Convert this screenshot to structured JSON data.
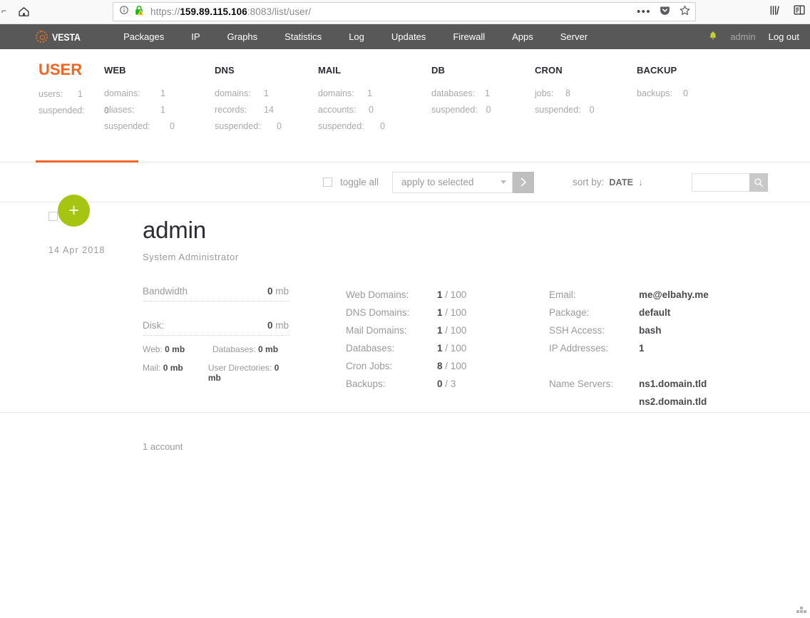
{
  "browser": {
    "home_icon": "home-icon",
    "info_icon": "info-icon",
    "lock_icon": "secure-lock-warning-icon",
    "url_scheme": "https://",
    "url_host": "159.89.115.106",
    "url_rest": ":8083/list/user/",
    "menu_icon": "ellipsis-icon",
    "pocket_icon": "pocket-icon",
    "bookmark_icon": "star-icon",
    "library_icon": "library-icon",
    "sidebar_icon": "reader-sidebar-icon"
  },
  "topnav": {
    "brand": "VESTA",
    "brand_icon": "vesta-logo-icon",
    "links": [
      {
        "label": "Packages"
      },
      {
        "label": "IP"
      },
      {
        "label": "Graphs"
      },
      {
        "label": "Statistics"
      },
      {
        "label": "Log"
      },
      {
        "label": "Updates"
      },
      {
        "label": "Firewall"
      },
      {
        "label": "Apps"
      },
      {
        "label": "Server"
      }
    ],
    "notification_icon": "bell-icon",
    "user": "admin",
    "logout": "Log out",
    "accent_color": "#f26522",
    "bar_color": "#585858"
  },
  "stats": {
    "groups": [
      {
        "title": "USER",
        "highlight": true,
        "rows": [
          {
            "key": "users:",
            "val": "1"
          },
          {
            "key": "suspended:",
            "val": "0"
          }
        ]
      },
      {
        "title": "WEB",
        "highlight": false,
        "rows": [
          {
            "key": "domains:",
            "val": "1"
          },
          {
            "key": "aliases:",
            "val": "1"
          },
          {
            "key": "suspended:",
            "val": "0"
          }
        ]
      },
      {
        "title": "DNS",
        "highlight": false,
        "rows": [
          {
            "key": "domains:",
            "val": "1"
          },
          {
            "key": "records:",
            "val": "14"
          },
          {
            "key": "suspended:",
            "val": "0"
          }
        ]
      },
      {
        "title": "MAIL",
        "highlight": false,
        "rows": [
          {
            "key": "domains:",
            "val": "1"
          },
          {
            "key": "accounts:",
            "val": "0"
          },
          {
            "key": "suspended:",
            "val": "0"
          }
        ]
      },
      {
        "title": "DB",
        "highlight": false,
        "rows": [
          {
            "key": "databases:",
            "val": "1"
          },
          {
            "key": "suspended:",
            "val": "0"
          }
        ]
      },
      {
        "title": "CRON",
        "highlight": false,
        "rows": [
          {
            "key": "jobs:",
            "val": "8"
          },
          {
            "key": "suspended:",
            "val": "0"
          }
        ]
      },
      {
        "title": "BACKUP",
        "highlight": false,
        "rows": [
          {
            "key": "backups:",
            "val": "0"
          }
        ]
      }
    ]
  },
  "toolbar": {
    "toggle_all": "toggle all",
    "apply_select_value": "apply to selected",
    "go_icon": "chevron-right-icon",
    "sort_label": "sort by:",
    "sort_value": "DATE",
    "sort_direction": "↓",
    "search_value": "",
    "search_placeholder": "",
    "search_icon": "search-icon"
  },
  "add_button": {
    "label": "+",
    "color": "#a6c513"
  },
  "record": {
    "date": "14 Apr 2018",
    "username": "admin",
    "role": "System Administrator",
    "usage": {
      "bandwidth_label": "Bandwidth",
      "bandwidth_value": "0",
      "bandwidth_unit": "mb",
      "disk_label": "Disk:",
      "disk_value": "0",
      "disk_unit": "mb",
      "sub": [
        {
          "k": "Web:",
          "v": "0 mb",
          "k2": "Databases:",
          "v2": "0 mb"
        },
        {
          "k": "Mail:",
          "v": "0 mb",
          "k2": "User Directories:",
          "v2": "0 mb"
        }
      ]
    },
    "quotas": [
      {
        "key": "Web Domains:",
        "used": "1",
        "limit": "/ 100"
      },
      {
        "key": "DNS Domains:",
        "used": "1",
        "limit": "/ 100"
      },
      {
        "key": "Mail Domains:",
        "used": "1",
        "limit": "/ 100"
      },
      {
        "key": "Databases:",
        "used": "1",
        "limit": "/ 100"
      },
      {
        "key": "Cron Jobs:",
        "used": "8",
        "limit": "/ 100"
      },
      {
        "key": "Backups:",
        "used": "0",
        "limit": "/ 3"
      }
    ],
    "info": [
      {
        "key": "Email:",
        "val": "me@elbahy.me"
      },
      {
        "key": "Package:",
        "val": "default"
      },
      {
        "key": "SSH Access:",
        "val": "bash"
      },
      {
        "key": "IP Addresses:",
        "val": "1"
      }
    ],
    "nameservers_label": "Name Servers:",
    "nameservers": [
      "ns1.domain.tld",
      "ns2.domain.tld"
    ]
  },
  "footer": {
    "count": "1 account"
  }
}
